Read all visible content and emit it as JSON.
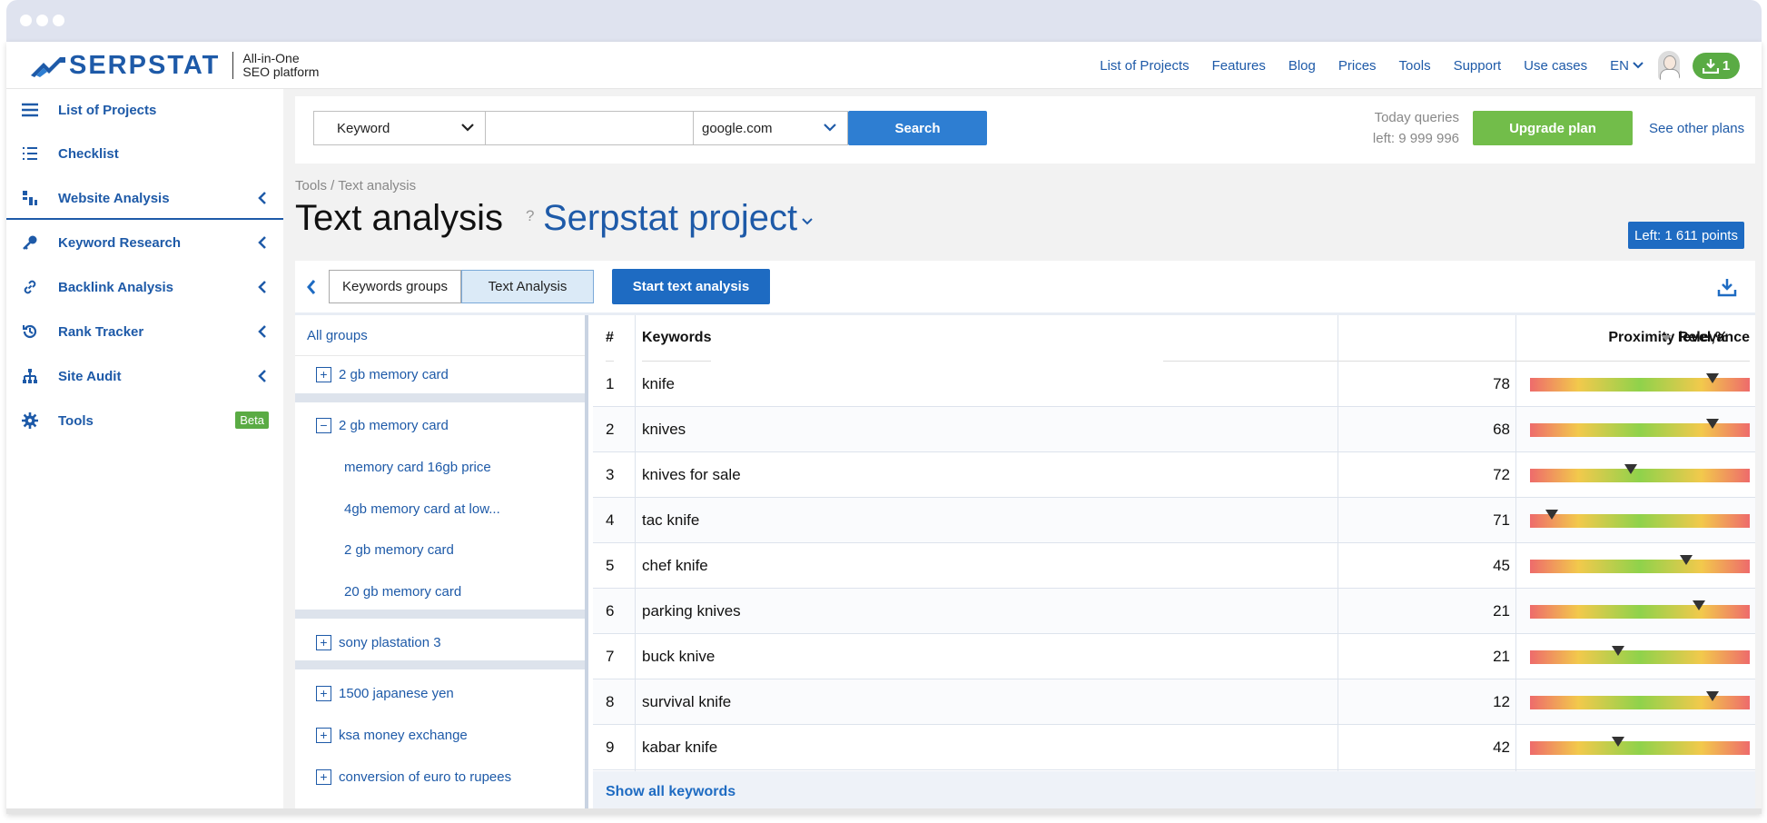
{
  "brand": {
    "name": "SERPSTAT",
    "tagline_line1": "All-in-One",
    "tagline_line2": "SEO platform",
    "color": "#1e5aa8"
  },
  "topnav": {
    "links": [
      "List of Projects",
      "Features",
      "Blog",
      "Prices",
      "Tools",
      "Support",
      "Use cases"
    ],
    "language": "EN",
    "downloads_count": "1"
  },
  "sidebar": {
    "items": [
      {
        "label": "List of Projects",
        "icon": "menu-icon"
      },
      {
        "label": "Checklist",
        "icon": "checklist-icon"
      },
      {
        "label": "Website Analysis",
        "icon": "bar-chart-icon"
      },
      {
        "label": "Keyword Research",
        "icon": "key-icon"
      },
      {
        "label": "Backlink Analysis",
        "icon": "link-icon"
      },
      {
        "label": "Rank Tracker",
        "icon": "history-icon"
      },
      {
        "label": "Site Audit",
        "icon": "sitemap-icon"
      },
      {
        "label": "Tools",
        "icon": "gear-icon"
      }
    ],
    "tools_badge": "Beta"
  },
  "search": {
    "type_selected": "Keyword",
    "query_value": "",
    "engine_selected": "google.com",
    "button_label": "Search",
    "queries_line1": "Today queries",
    "queries_line2": "left: 9 999 996",
    "upgrade_label": "Upgrade plan",
    "other_plans_label": "See other plans"
  },
  "page": {
    "breadcrumb": "Tools / Text analysis",
    "title": "Text analysis",
    "help": "?",
    "project": "Serpstat project",
    "points_left": "Left: 1 611 points"
  },
  "tabs": {
    "groups_label": "Keywords groups",
    "analysis_label": "Text Analysis",
    "start_label": "Start text analysis"
  },
  "groups": {
    "header": "All groups",
    "items": [
      {
        "label": "2 gb memory card",
        "state": "+"
      },
      {
        "label": "2 gb memory card",
        "state": "−"
      },
      {
        "label": "memory card 16gb price",
        "state": "child"
      },
      {
        "label": "4gb memory card at low...",
        "state": "child"
      },
      {
        "label": "2 gb memory card",
        "state": "child"
      },
      {
        "label": "20 gb memory card",
        "state": "child"
      },
      {
        "label": "sony plastation 3",
        "state": "+"
      },
      {
        "label": "1500 japanese yen",
        "state": "+"
      },
      {
        "label": "ksa money exchange",
        "state": "+"
      },
      {
        "label": "conversion of euro to rupees",
        "state": "+"
      }
    ]
  },
  "table": {
    "headers": {
      "num": "#",
      "keywords": "Keywords",
      "proximity": "Proximity level,%",
      "relevance": "Relevance"
    },
    "rows": [
      {
        "num": "1",
        "keyword": "knife",
        "proximity": "78",
        "relevance": 0.83
      },
      {
        "num": "2",
        "keyword": "knives",
        "proximity": "68",
        "relevance": 0.83
      },
      {
        "num": "3",
        "keyword": "knives for sale",
        "proximity": "72",
        "relevance": 0.46
      },
      {
        "num": "4",
        "keyword": "tac knife",
        "proximity": "71",
        "relevance": 0.1
      },
      {
        "num": "5",
        "keyword": "chef knife",
        "proximity": "45",
        "relevance": 0.71
      },
      {
        "num": "6",
        "keyword": "parking knives",
        "proximity": "21",
        "relevance": 0.77
      },
      {
        "num": "7",
        "keyword": "buck knive",
        "proximity": "21",
        "relevance": 0.4
      },
      {
        "num": "8",
        "keyword": "survival knife",
        "proximity": "12",
        "relevance": 0.83
      },
      {
        "num": "9",
        "keyword": "kabar knife",
        "proximity": "42",
        "relevance": 0.4
      }
    ],
    "show_all_label": "Show all keywords"
  },
  "colors": {
    "accent_blue": "#1e6bc2",
    "upgrade_green": "#72bd4a",
    "badge_green": "#5aab44"
  }
}
